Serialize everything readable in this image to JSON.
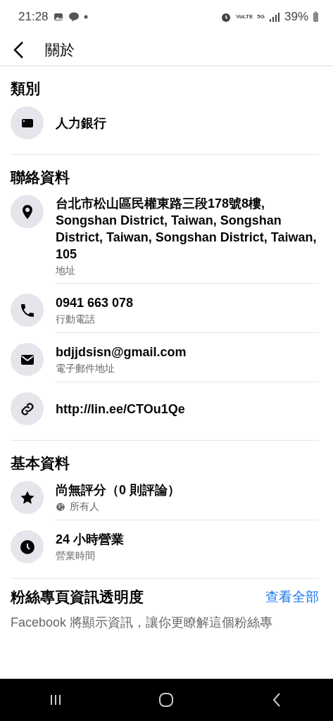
{
  "status_bar": {
    "time": "21:28",
    "indicators": [
      "VoLTE",
      "5G"
    ],
    "battery": "39%"
  },
  "header": {
    "title": "關於"
  },
  "sections": [
    {
      "title": "類別",
      "rows": [
        {
          "kind": "category",
          "text": "人力銀行"
        }
      ]
    },
    {
      "title": "聯絡資料",
      "rows": [
        {
          "kind": "address",
          "text": "台北市松山區民權東路三段178號8樓, Songshan District, Taiwan, Songshan District, Taiwan, Songshan District, Taiwan, 105",
          "sub": "地址"
        },
        {
          "kind": "phone",
          "text": "0941 663 078",
          "sub": "行動電話"
        },
        {
          "kind": "email",
          "text": "bdjjdsisn@gmail.com",
          "sub": "電子郵件地址"
        },
        {
          "kind": "website",
          "text": "http://lin.ee/CTOu1Qe"
        }
      ]
    },
    {
      "title": "基本資料",
      "rows": [
        {
          "kind": "rating",
          "text": "尚無評分（0 則評論）",
          "sub": "所有人"
        },
        {
          "kind": "hours",
          "text": "24 小時營業",
          "sub": "營業時間"
        }
      ]
    }
  ],
  "transparency": {
    "title": "粉絲專頁資訊透明度",
    "link": "查看全部",
    "text": "Facebook 將顯示資訊，讓你更瞭解這個粉絲專"
  }
}
